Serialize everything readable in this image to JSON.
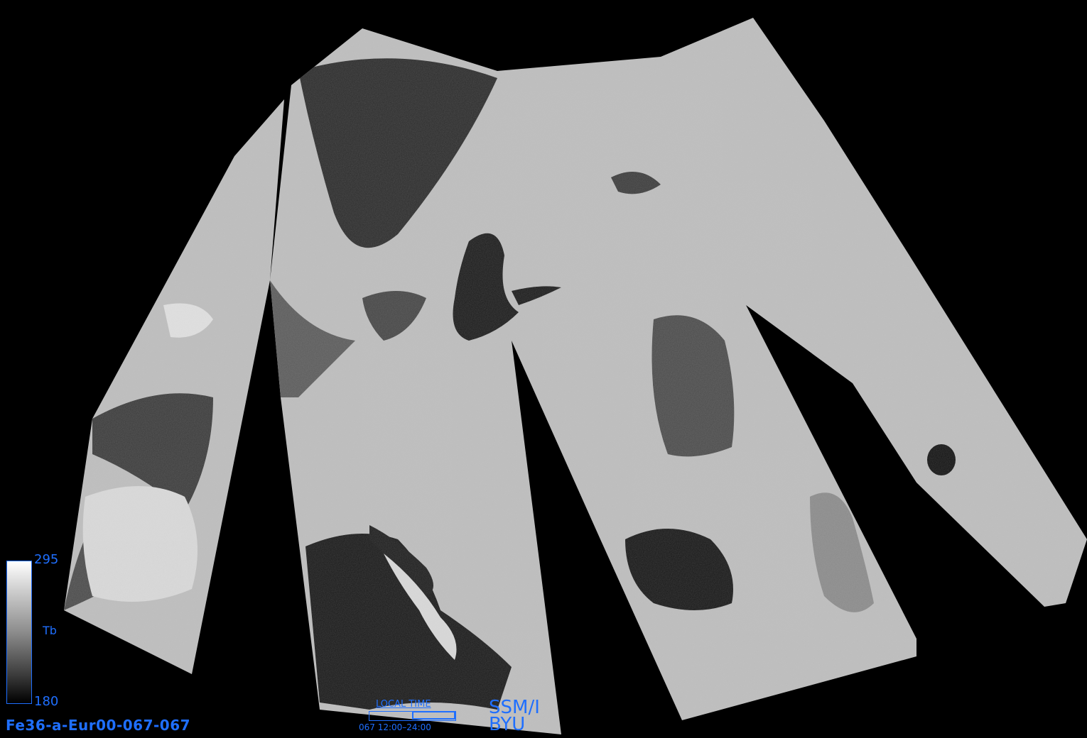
{
  "image": {
    "product_id": "Fe36-a-Eur00-067-067",
    "sensor": "SSM/I",
    "organization": "BYU"
  },
  "colorbar": {
    "max": "295",
    "min": "180",
    "label": "Tb",
    "colors": {
      "high": "#ffffff",
      "low": "#000000",
      "frame": "#1f6fff"
    }
  },
  "local_time": {
    "label": "LOCAL TIME",
    "range_text": "067  12:00–24:00"
  },
  "styles": {
    "text_color": "#1f6fff",
    "background": "#000000",
    "land_color": "#e6e6e6",
    "sea_color": "#151515"
  }
}
